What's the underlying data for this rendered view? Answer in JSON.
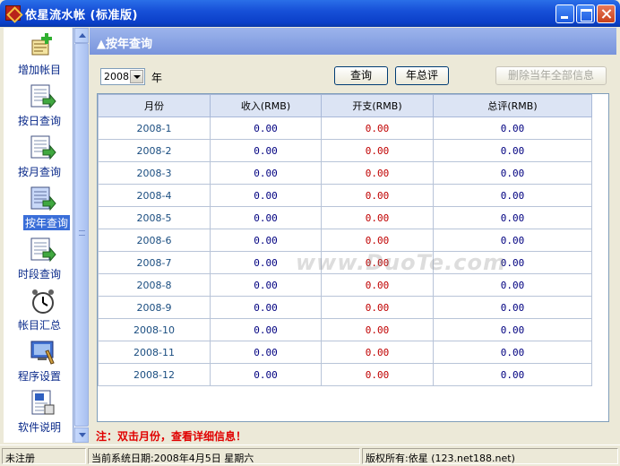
{
  "window": {
    "title": "依星流水帐 (标准版)"
  },
  "sidebar": {
    "items": [
      {
        "label": "增加帐目",
        "icon": "add-account-icon"
      },
      {
        "label": "按日查询",
        "icon": "daily-query-icon"
      },
      {
        "label": "按月查询",
        "icon": "monthly-query-icon"
      },
      {
        "label": "按年查询",
        "icon": "yearly-query-icon"
      },
      {
        "label": "时段查询",
        "icon": "period-query-icon"
      },
      {
        "label": "帐目汇总",
        "icon": "alarm-clock-icon"
      },
      {
        "label": "程序设置",
        "icon": "settings-icon"
      },
      {
        "label": "软件说明",
        "icon": "help-document-icon"
      }
    ],
    "selected": "按年查询"
  },
  "header": {
    "title": "▲按年查询"
  },
  "toolbar": {
    "year_value": "2008",
    "year_unit": "年",
    "query_label": "查询",
    "annual_label": "年总评",
    "delete_label": "删除当年全部信息"
  },
  "table": {
    "headers": [
      "月份",
      "收入(RMB)",
      "开支(RMB)",
      "总评(RMB)"
    ],
    "rows": [
      [
        "2008-1",
        "0.00",
        "0.00",
        "0.00"
      ],
      [
        "2008-2",
        "0.00",
        "0.00",
        "0.00"
      ],
      [
        "2008-3",
        "0.00",
        "0.00",
        "0.00"
      ],
      [
        "2008-4",
        "0.00",
        "0.00",
        "0.00"
      ],
      [
        "2008-5",
        "0.00",
        "0.00",
        "0.00"
      ],
      [
        "2008-6",
        "0.00",
        "0.00",
        "0.00"
      ],
      [
        "2008-7",
        "0.00",
        "0.00",
        "0.00"
      ],
      [
        "2008-8",
        "0.00",
        "0.00",
        "0.00"
      ],
      [
        "2008-9",
        "0.00",
        "0.00",
        "0.00"
      ],
      [
        "2008-10",
        "0.00",
        "0.00",
        "0.00"
      ],
      [
        "2008-11",
        "0.00",
        "0.00",
        "0.00"
      ],
      [
        "2008-12",
        "0.00",
        "0.00",
        "0.00"
      ]
    ]
  },
  "note": "注：双击月份，查看详细信息！",
  "watermark": "www.DuoTe.com",
  "statusbar": {
    "registration": "未注册",
    "date": "当前系统日期:2008年4月5日 星期六",
    "copyright": "版权所有:依星 (123.net188.net)"
  }
}
